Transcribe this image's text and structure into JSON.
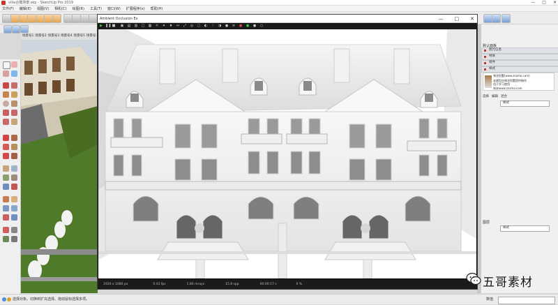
{
  "app": {
    "title": "villa合模场景.skp - SketchUp Pro 2019",
    "window_controls": [
      "—",
      "□",
      "✕"
    ]
  },
  "menu": [
    "文件(F)",
    "编辑(E)",
    "视图(V)",
    "相机(C)",
    "绘图(R)",
    "工具(T)",
    "窗口(W)",
    "扩展程序(x)",
    "帮助(H)"
  ],
  "scenes": [
    "场景号1",
    "场景号2",
    "场景号3",
    "场景号4",
    "场景号5",
    "场景号"
  ],
  "ao_window": {
    "title": "Ambient Occlusion Ex",
    "controls": [
      "—",
      "□",
      "✕"
    ],
    "status": {
      "resolution": "1920 x 1080 px",
      "fps": "0.43 fps",
      "mrays": "1.80 mrays",
      "spp": "15.8 spp",
      "time": "00:00:17 s",
      "percent": "6 %"
    }
  },
  "tray": {
    "title": "默认面板",
    "sections": [
      "图元信息",
      "材质",
      "组件",
      "样式"
    ],
    "tag_card": {
      "line1": "琴浓別墅(www.znzmo.com)",
      "line2": "本模型由琴浓別墅提供制作",
      "line3": "用于学习使用",
      "line4": "知末www.znzmo.com"
    },
    "tabs": [
      "选择",
      "编辑",
      "混合"
    ],
    "select_value": "样式",
    "lower_header": "图层",
    "lower_select_value": "样式"
  },
  "statusbar": {
    "hint": "选择对象。切换到扩充选择。拖动鼠标选择多项。",
    "vcb_label": "数值"
  },
  "watermark": {
    "text": "五哥素材"
  },
  "colors": {
    "ao_background": "#ffffff",
    "grass": "#4f7a2a",
    "tray_header": "#dfe3e8"
  }
}
